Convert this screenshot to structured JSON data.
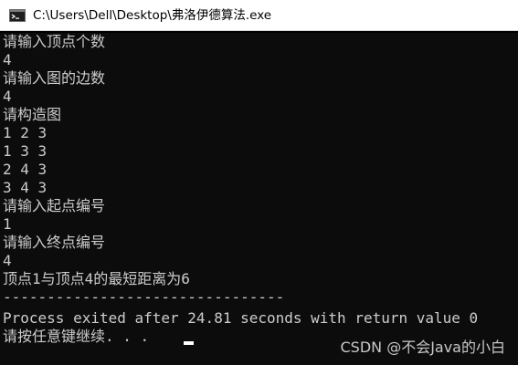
{
  "window": {
    "title": "C:\\Users\\Dell\\Desktop\\弗洛伊德算法.exe",
    "icon": "console-app-icon"
  },
  "console": {
    "lines": [
      "请输入顶点个数",
      "4",
      "请输入图的边数",
      "4",
      "请构造图",
      "1 2 3",
      "1 3 3",
      "2 4 3",
      "3 4 3",
      "请输入起点编号",
      "1",
      "请输入终点编号",
      "4",
      "顶点1与顶点4的最短距离为6",
      "--------------------------------",
      "Process exited after 24.81 seconds with return value 0",
      "请按任意键继续. . ."
    ],
    "colors": {
      "background": "#0c0c0c",
      "text": "#cccccc"
    }
  },
  "watermark": {
    "text": "CSDN @不会Java的小白"
  }
}
